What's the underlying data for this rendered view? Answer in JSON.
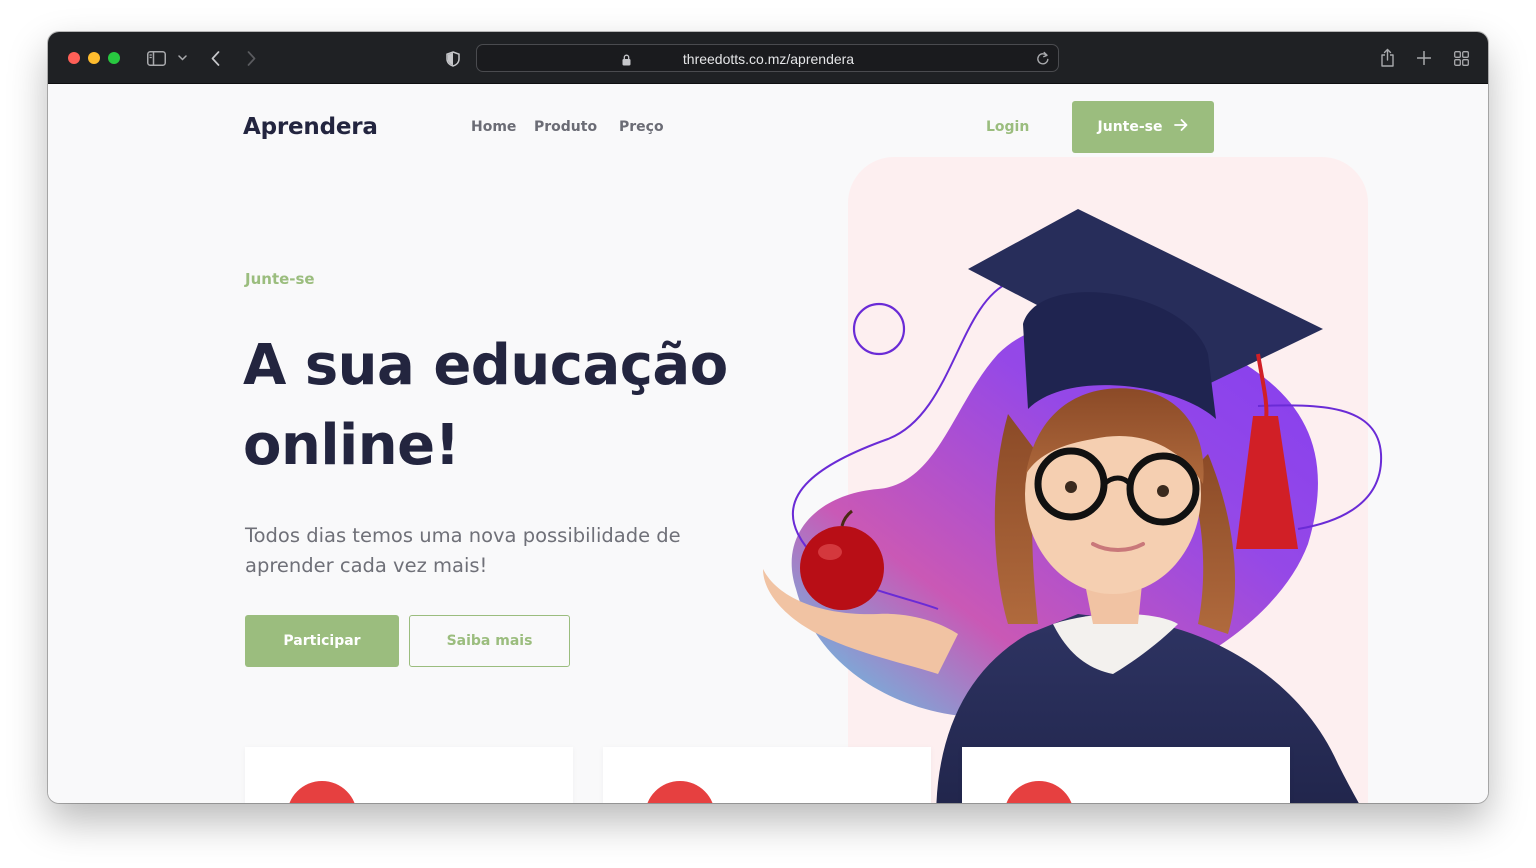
{
  "browser": {
    "url": "threedotts.co.mz/aprendera",
    "icons": [
      "sidebar-icon",
      "chevron-down-icon",
      "back-icon",
      "forward-icon",
      "shield-icon",
      "lock-icon",
      "reload-icon",
      "share-icon",
      "plus-icon",
      "tabs-grid-icon"
    ]
  },
  "header": {
    "logo": "Aprendera",
    "nav": [
      "Home",
      "Produto",
      "Preço"
    ],
    "login": "Login",
    "join": "Junte-se"
  },
  "hero": {
    "eyebrow": "Junte-se",
    "headline_line1": "A sua educação",
    "headline_line2": "online!",
    "subtitle": "Todos dias temos uma nova possibilidade de aprender cada vez mais!",
    "primary_button": "Participar",
    "secondary_button": "Saiba mais"
  },
  "colors": {
    "accent": "#9bbd7e",
    "heading": "#23253f",
    "body_text": "#6f7078",
    "hero_panel": "#fdeff0",
    "blob_start": "#7a2ff0",
    "blob_end": "#e05590",
    "card_dot": "#e64040"
  }
}
